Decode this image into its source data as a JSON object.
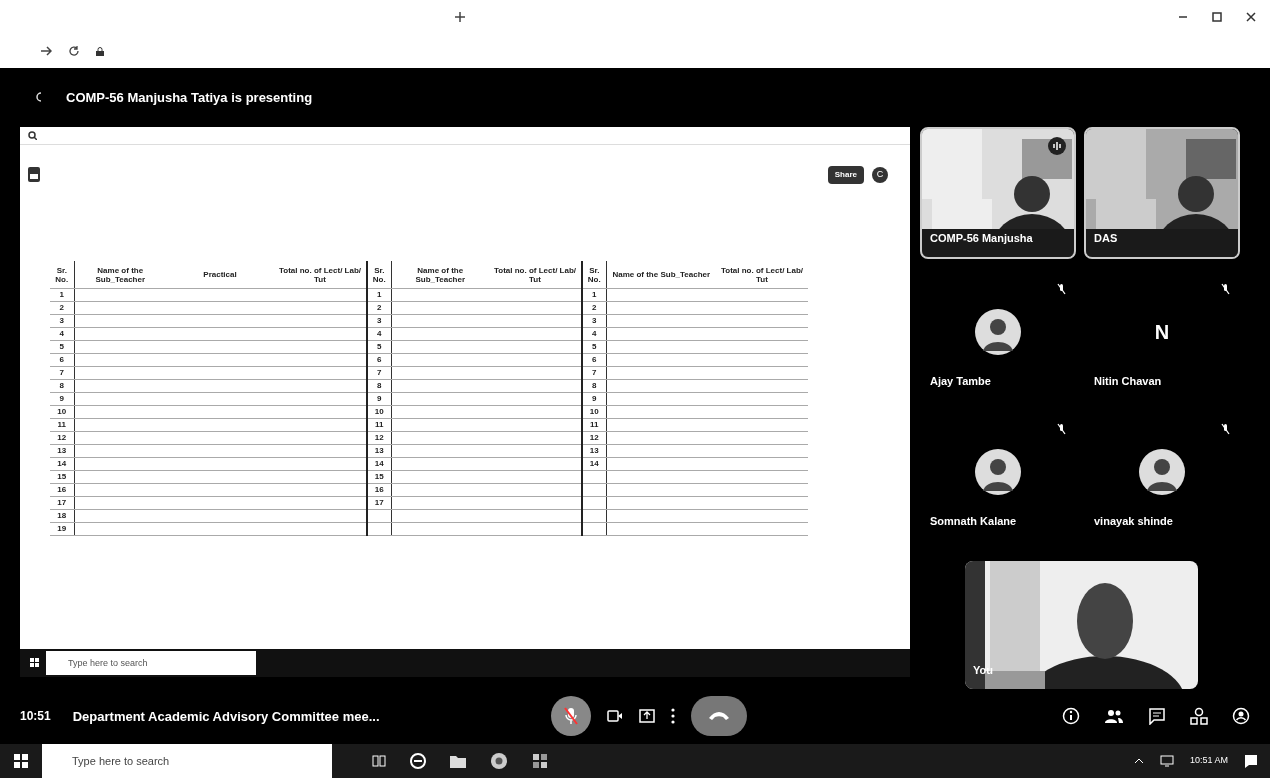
{
  "meeting": {
    "presenting_banner": "COMP-56 Manjusha Tatiya is presenting",
    "time": "10:51",
    "title": "Department Academic Advisory Committee mee...",
    "mic_muted": true
  },
  "shared_screen": {
    "share_button": "Share",
    "avatar_letter": "C",
    "taskbar_search": "Type here to search",
    "sections": [
      {
        "headers": [
          "Sr. No.",
          "Name of the Sub_Teacher",
          "Practical",
          "Total no. of Lect/ Lab/ Tut"
        ],
        "serials": [
          "1",
          "2",
          "3",
          "4",
          "5",
          "6",
          "7",
          "8",
          "9",
          "10",
          "11",
          "12",
          "13",
          "14",
          "15",
          "16",
          "17",
          "18",
          "19"
        ]
      },
      {
        "headers": [
          "Sr. No.",
          "Name of the Sub_Teacher",
          "Total no. of Lect/ Lab/ Tut"
        ],
        "serials": [
          "1",
          "2",
          "3",
          "4",
          "5",
          "6",
          "7",
          "8",
          "9",
          "10",
          "11",
          "12",
          "13",
          "14",
          "15",
          "16",
          "17"
        ]
      },
      {
        "headers": [
          "Sr. No.",
          "Name of the Sub_Teacher",
          "Total no. of Lect/ Lab/ Tut"
        ],
        "serials": [
          "1",
          "2",
          "3",
          "4",
          "5",
          "6",
          "7",
          "8",
          "9",
          "10",
          "11",
          "12",
          "13",
          "14"
        ]
      }
    ]
  },
  "participant_rows": [
    {
      "tiles": [
        {
          "name": "COMP-56 Manjusha",
          "kind": "video",
          "speaking": true
        },
        {
          "name": "DAS",
          "kind": "video"
        }
      ]
    },
    {
      "tiles": [
        {
          "name": "Ajay Tambe",
          "kind": "avatar",
          "muted": true
        },
        {
          "name": "Nitin Chavan",
          "kind": "letter",
          "letter": "N",
          "muted": true
        }
      ]
    },
    {
      "tiles": [
        {
          "name": "Somnath Kalane",
          "kind": "avatar",
          "muted": true
        },
        {
          "name": "vinayak shinde",
          "kind": "avatar",
          "muted": true
        }
      ]
    }
  ],
  "self_view": {
    "name": "You"
  },
  "taskbar": {
    "search_placeholder": "Type here to search",
    "time": "10:51 AM"
  }
}
